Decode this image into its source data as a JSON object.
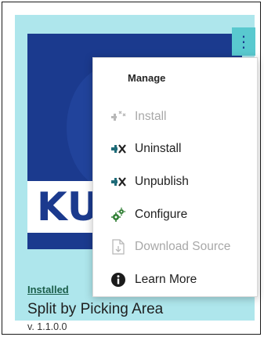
{
  "tile": {
    "status_link": "Installed",
    "title": "Split by Picking Area",
    "version": "v. 1.1.0.0",
    "logo_text": "KU",
    "more_button_glyph": "⋮"
  },
  "menu": {
    "header": "Manage",
    "items": [
      {
        "label": "Install",
        "icon": "install-icon",
        "enabled": false
      },
      {
        "label": "Uninstall",
        "icon": "uninstall-icon",
        "enabled": true
      },
      {
        "label": "Unpublish",
        "icon": "unpublish-icon",
        "enabled": true
      },
      {
        "label": "Configure",
        "icon": "configure-icon",
        "enabled": true
      },
      {
        "label": "Download Source",
        "icon": "download-source-icon",
        "enabled": false
      },
      {
        "label": "Learn More",
        "icon": "info-icon",
        "enabled": true
      }
    ]
  },
  "colors": {
    "tile_background": "#aee6ec",
    "logo_background": "#1b3a8e",
    "more_button_background": "#59c9cf",
    "status_link": "#1b5e4a",
    "action_icon": "#1f6b78",
    "configure_icon": "#2e7d32",
    "disabled": "#a8a8a8"
  }
}
